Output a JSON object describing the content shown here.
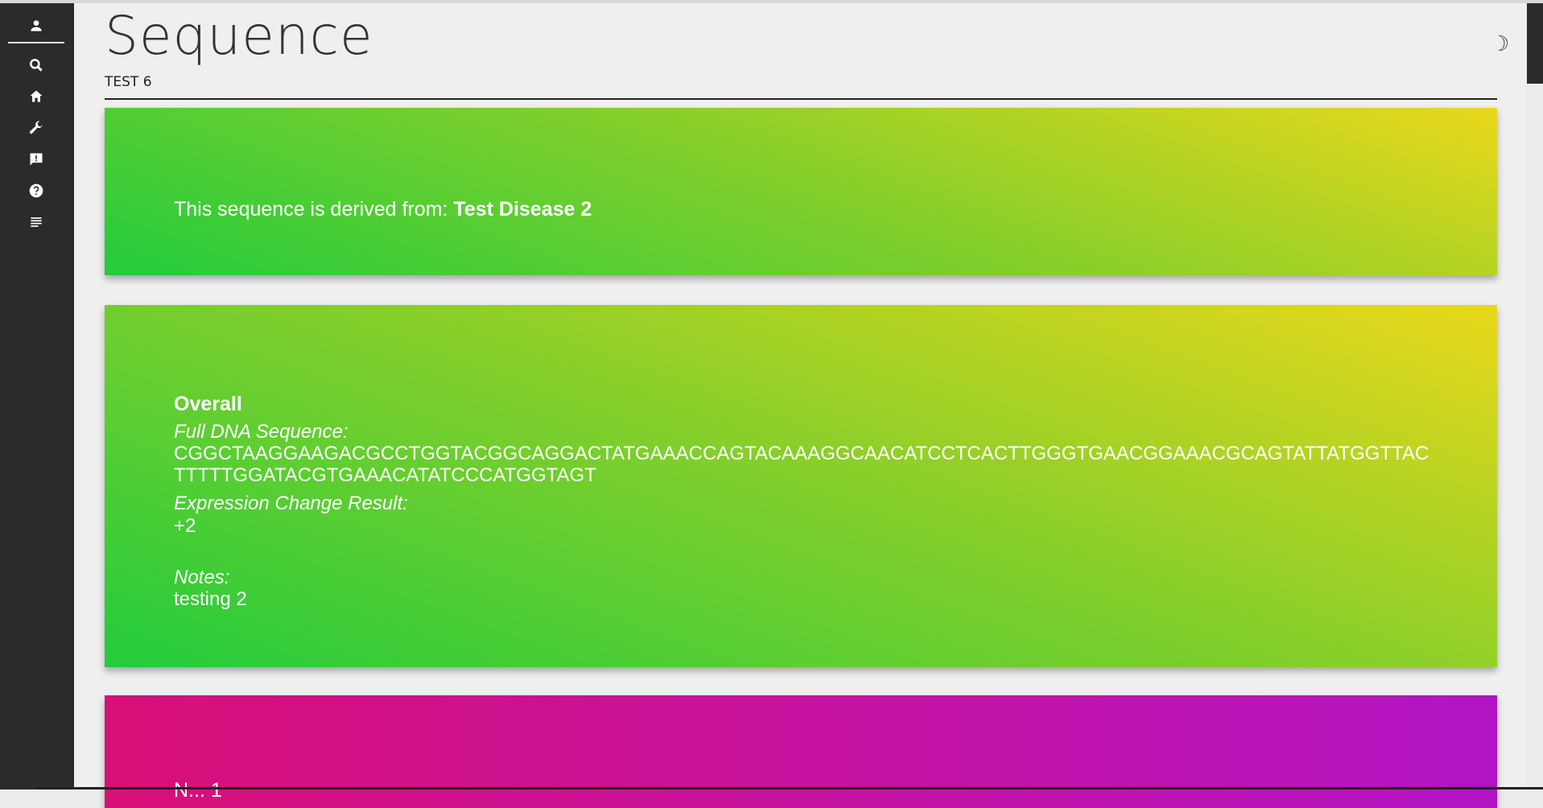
{
  "sidebar": {
    "items": [
      {
        "name": "account",
        "icon": "person-icon"
      },
      {
        "name": "search",
        "icon": "search-icon"
      },
      {
        "name": "home",
        "icon": "home-icon"
      },
      {
        "name": "tools",
        "icon": "wrench-icon"
      },
      {
        "name": "feedback",
        "icon": "feedback-icon"
      },
      {
        "name": "help",
        "icon": "help-icon"
      },
      {
        "name": "list",
        "icon": "list-icon"
      }
    ]
  },
  "header": {
    "title": "Sequence",
    "subtitle": "TEST 6",
    "theme_toggle_icon": "☽"
  },
  "derived_card": {
    "prefix": "This sequence is derived from: ",
    "disease": "Test Disease 2"
  },
  "overall_card": {
    "title": "Overall",
    "dna_label": "Full DNA Sequence:",
    "dna_value": "CGGCTAAGGAAGACGCCTGGTACGGCAGGACTATGAAACCAGTACAAAGGCAACATCCTCACTTGGGTGAACGGAAACGCAGTATTATGGTTACTTTTTGGATACGTGAAACATATCCCATGGTAGT",
    "expression_label": "Expression Change Result:",
    "expression_value": "+2",
    "notes_label": "Notes:",
    "notes_value": "testing 2"
  },
  "next_card": {
    "partial_text": "N... 1"
  },
  "colors": {
    "sidebar_bg": "#2b2b2b",
    "green_start": "#22cc3c",
    "green_end": "#ead81b",
    "pink_start": "#d80f77",
    "pink_end": "#b214c4"
  }
}
